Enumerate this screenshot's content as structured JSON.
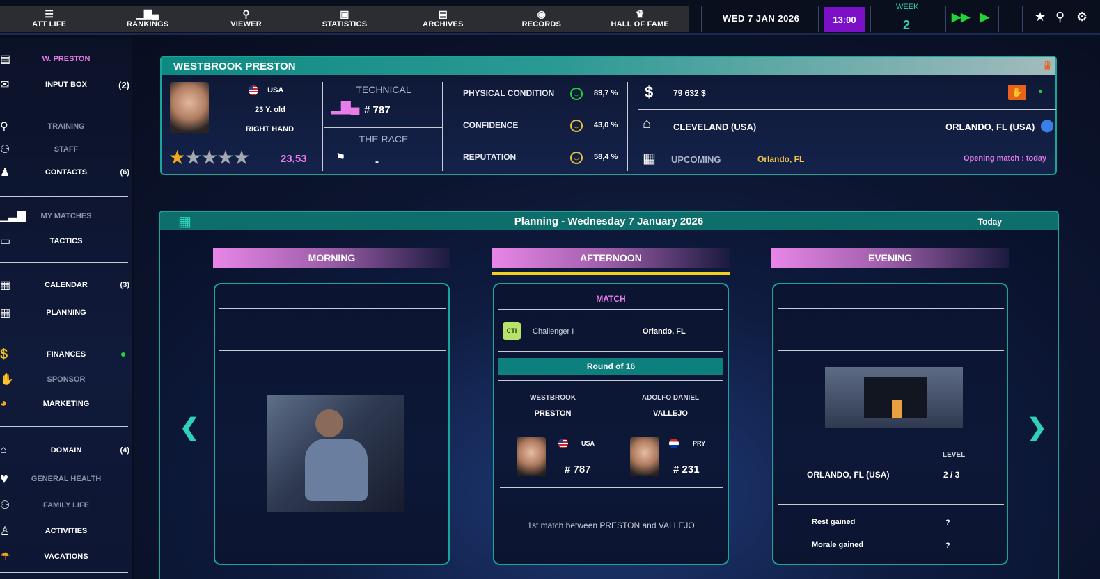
{
  "nav": {
    "items": [
      {
        "label": "ATT LIFE",
        "icon": "person-list-icon"
      },
      {
        "label": "RANKINGS",
        "icon": "podium-icon"
      },
      {
        "label": "VIEWER",
        "icon": "magnifier-icon"
      },
      {
        "label": "STATISTICS",
        "icon": "monitor-chart-icon"
      },
      {
        "label": "ARCHIVES",
        "icon": "archive-icon"
      },
      {
        "label": "RECORDS",
        "icon": "record-icon"
      },
      {
        "label": "HALL OF FAME",
        "icon": "trophy-icon"
      }
    ],
    "date": "WED  7  JAN  2026",
    "time": "13:00",
    "week_label": "WEEK",
    "week_number": "2"
  },
  "sidebar": {
    "player_short": "W. PRESTON",
    "input_box": {
      "label": "INPUT BOX",
      "count": "(2)"
    },
    "training": "TRAINING",
    "staff": "STAFF",
    "contacts": {
      "label": "CONTACTS",
      "count": "(6)"
    },
    "my_matches": "MY MATCHES",
    "tactics": "TACTICS",
    "calendar": {
      "label": "CALENDAR",
      "count": "(3)"
    },
    "planning": "PLANNING",
    "finances": "FINANCES",
    "sponsor": "SPONSOR",
    "marketing": "MARKETING",
    "domain": {
      "label": "DOMAIN",
      "count": "(4)"
    },
    "general_health": "GENERAL HEALTH",
    "family_life": "FAMILY LIFE",
    "activities": "ACTIVITIES",
    "vacations": "VACATIONS"
  },
  "player": {
    "full_name": "WESTBROOK PRESTON",
    "country": "USA",
    "age": "23 Y. old",
    "hand": "RIGHT HAND",
    "stars": 1,
    "stars_total": 5,
    "rating": "23,53",
    "technical_label": "TECHNICAL",
    "technical_rank": "# 787",
    "race_label": "THE RACE",
    "race_value": "-",
    "physical_label": "PHYSICAL CONDITION",
    "physical_value": "89,7 %",
    "confidence_label": "CONFIDENCE",
    "confidence_value": "43,0 %",
    "reputation_label": "REPUTATION",
    "reputation_value": "58,4 %",
    "money": "79 632 $",
    "home": "CLEVELAND (USA)",
    "location": "ORLANDO, FL (USA)",
    "upcoming_label": "UPCOMING",
    "upcoming_link": "Orlando, FL",
    "opening": "Opening match : today"
  },
  "planning": {
    "title": "Planning - Wednesday 7 January 2026",
    "today": "Today",
    "morning": "MORNING",
    "afternoon": "AFTERNOON",
    "evening": "EVENING",
    "match": {
      "label": "MATCH",
      "tournament": "Challenger I",
      "tournament_icon": "CTI",
      "city": "Orlando, FL",
      "round": "Round of 16",
      "p1_first": "WESTBROOK",
      "p1_last": "PRESTON",
      "p1_country": "USA",
      "p1_rank": "# 787",
      "p2_first": "ADOLFO DANIEL",
      "p2_last": "VALLEJO",
      "p2_country": "PRY",
      "p2_rank": "# 231",
      "note": "1st match between PRESTON and VALLEJO"
    },
    "evening_info": {
      "level_label": "LEVEL",
      "location": "ORLANDO, FL (USA)",
      "level": "2 / 3",
      "rest_label": "Rest gained",
      "rest_value": "?",
      "morale_label": "Morale gained",
      "morale_value": "?"
    }
  },
  "colors": {
    "accent_teal": "#1aa59a",
    "accent_pink": "#e87ce8",
    "time_purple": "#7b10c6",
    "play_green": "#22d33a",
    "highlight_yellow": "#f2d01c"
  }
}
